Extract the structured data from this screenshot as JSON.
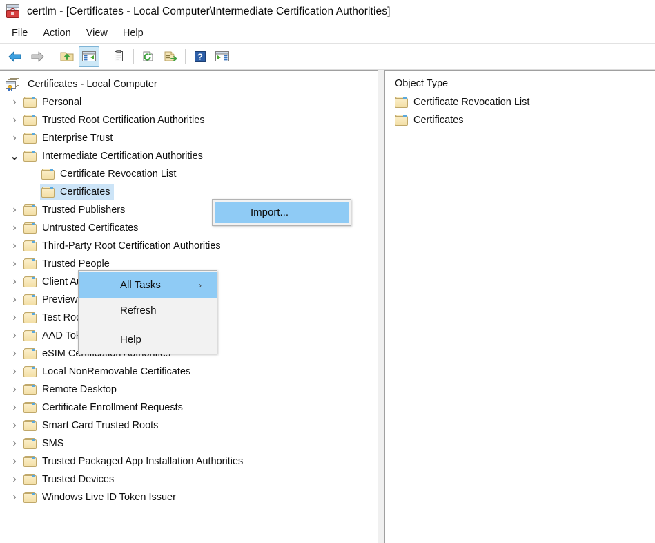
{
  "window": {
    "title": "certlm - [Certificates - Local Computer\\Intermediate Certification Authorities]",
    "app_icon": "mmc-console-icon"
  },
  "menubar": {
    "items": [
      {
        "label": "File",
        "name": "menu-file"
      },
      {
        "label": "Action",
        "name": "menu-action"
      },
      {
        "label": "View",
        "name": "menu-view"
      },
      {
        "label": "Help",
        "name": "menu-help"
      }
    ]
  },
  "toolbar": {
    "buttons": [
      {
        "icon": "back-arrow-icon",
        "active": false
      },
      {
        "icon": "forward-arrow-icon",
        "active": false
      },
      {
        "icon": "up-folder-icon",
        "active": false
      },
      {
        "icon": "show-hide-console-tree-icon",
        "active": true
      },
      {
        "icon": "properties-clipboard-icon",
        "active": false
      },
      {
        "icon": "refresh-icon",
        "active": false
      },
      {
        "icon": "export-list-icon",
        "active": false
      },
      {
        "icon": "help-icon",
        "active": false
      },
      {
        "icon": "show-action-pane-icon",
        "active": false
      }
    ]
  },
  "tree": {
    "root": {
      "label": "Certificates - Local Computer",
      "icon": "certificates-console-root-icon"
    },
    "items": [
      {
        "label": "Personal",
        "indent": 1,
        "twisty": "collapsed",
        "selected": false
      },
      {
        "label": "Trusted Root Certification Authorities",
        "indent": 1,
        "twisty": "collapsed",
        "selected": false
      },
      {
        "label": "Enterprise Trust",
        "indent": 1,
        "twisty": "collapsed",
        "selected": false
      },
      {
        "label": "Intermediate Certification Authorities",
        "indent": 1,
        "twisty": "expanded",
        "selected": false
      },
      {
        "label": "Certificate Revocation List",
        "indent": 2,
        "twisty": "none",
        "selected": false
      },
      {
        "label": "Certificates",
        "indent": 2,
        "twisty": "none",
        "selected": true
      },
      {
        "label": "Trusted Publishers",
        "indent": 1,
        "twisty": "collapsed",
        "selected": false
      },
      {
        "label": "Untrusted Certificates",
        "indent": 1,
        "twisty": "collapsed",
        "selected": false
      },
      {
        "label": "Third-Party Root Certification Authorities",
        "indent": 1,
        "twisty": "collapsed",
        "selected": false
      },
      {
        "label": "Trusted People",
        "indent": 1,
        "twisty": "collapsed",
        "selected": false
      },
      {
        "label": "Client Authentication Issuers",
        "indent": 1,
        "twisty": "collapsed",
        "selected": false
      },
      {
        "label": "Preview Build Roots",
        "indent": 1,
        "twisty": "collapsed",
        "selected": false
      },
      {
        "label": "Test Roots",
        "indent": 1,
        "twisty": "collapsed",
        "selected": false
      },
      {
        "label": "AAD Token Issuer",
        "indent": 1,
        "twisty": "collapsed",
        "selected": false
      },
      {
        "label": "eSIM Certification Authorities",
        "indent": 1,
        "twisty": "collapsed",
        "selected": false
      },
      {
        "label": "Local NonRemovable Certificates",
        "indent": 1,
        "twisty": "collapsed",
        "selected": false
      },
      {
        "label": "Remote Desktop",
        "indent": 1,
        "twisty": "collapsed",
        "selected": false
      },
      {
        "label": "Certificate Enrollment Requests",
        "indent": 1,
        "twisty": "collapsed",
        "selected": false
      },
      {
        "label": "Smart Card Trusted Roots",
        "indent": 1,
        "twisty": "collapsed",
        "selected": false
      },
      {
        "label": "SMS",
        "indent": 1,
        "twisty": "collapsed",
        "selected": false
      },
      {
        "label": "Trusted Packaged App Installation Authorities",
        "indent": 1,
        "twisty": "collapsed",
        "selected": false
      },
      {
        "label": "Trusted Devices",
        "indent": 1,
        "twisty": "collapsed",
        "selected": false
      },
      {
        "label": "Windows Live ID Token Issuer",
        "indent": 1,
        "twisty": "collapsed",
        "selected": false
      }
    ],
    "twisty_glyphs": {
      "collapsed": "›",
      "expanded": "⌄"
    }
  },
  "list_pane": {
    "header": "Object Type",
    "rows": [
      {
        "label": "Certificate Revocation List",
        "icon": "folder-icon"
      },
      {
        "label": "Certificates",
        "icon": "folder-icon"
      }
    ]
  },
  "context_menu": {
    "items": [
      {
        "label": "All Tasks",
        "highlight": true,
        "has_submenu": true
      },
      {
        "label": "Refresh",
        "highlight": false,
        "has_submenu": false
      },
      {
        "label": "Help",
        "highlight": false,
        "has_submenu": false
      }
    ],
    "submenu_arrow": "›",
    "submenu": {
      "items": [
        {
          "label": "Import...",
          "highlight": true
        }
      ]
    }
  },
  "colors": {
    "menu_highlight": "#8fcbf5",
    "tree_selection": "#cce4f7",
    "toolbar_active": "#cde8f7",
    "folder": "#f3dfa6"
  }
}
